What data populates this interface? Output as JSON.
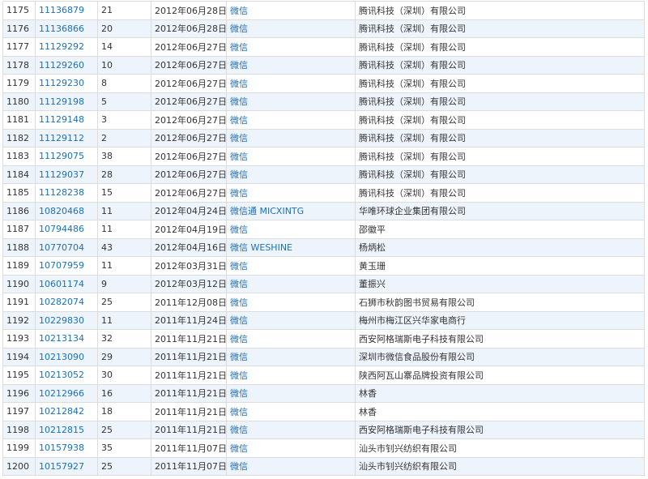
{
  "rows": [
    {
      "no": "1175",
      "reg": "11136879",
      "cls": "21",
      "date": "2012年06月28日",
      "mark": "微信",
      "owner": "腾讯科技（深圳）有限公司"
    },
    {
      "no": "1176",
      "reg": "11136866",
      "cls": "20",
      "date": "2012年06月28日",
      "mark": "微信",
      "owner": "腾讯科技（深圳）有限公司"
    },
    {
      "no": "1177",
      "reg": "11129292",
      "cls": "14",
      "date": "2012年06月27日",
      "mark": "微信",
      "owner": "腾讯科技（深圳）有限公司"
    },
    {
      "no": "1178",
      "reg": "11129260",
      "cls": "10",
      "date": "2012年06月27日",
      "mark": "微信",
      "owner": "腾讯科技（深圳）有限公司"
    },
    {
      "no": "1179",
      "reg": "11129230",
      "cls": "8",
      "date": "2012年06月27日",
      "mark": "微信",
      "owner": "腾讯科技（深圳）有限公司"
    },
    {
      "no": "1180",
      "reg": "11129198",
      "cls": "5",
      "date": "2012年06月27日",
      "mark": "微信",
      "owner": "腾讯科技（深圳）有限公司"
    },
    {
      "no": "1181",
      "reg": "11129148",
      "cls": "3",
      "date": "2012年06月27日",
      "mark": "微信",
      "owner": "腾讯科技（深圳）有限公司"
    },
    {
      "no": "1182",
      "reg": "11129112",
      "cls": "2",
      "date": "2012年06月27日",
      "mark": "微信",
      "owner": "腾讯科技（深圳）有限公司"
    },
    {
      "no": "1183",
      "reg": "11129075",
      "cls": "38",
      "date": "2012年06月27日",
      "mark": "微信",
      "owner": "腾讯科技（深圳）有限公司"
    },
    {
      "no": "1184",
      "reg": "11129037",
      "cls": "28",
      "date": "2012年06月27日",
      "mark": "微信",
      "owner": "腾讯科技（深圳）有限公司"
    },
    {
      "no": "1185",
      "reg": "11128238",
      "cls": "15",
      "date": "2012年06月27日",
      "mark": "微信",
      "owner": "腾讯科技（深圳）有限公司"
    },
    {
      "no": "1186",
      "reg": "10820468",
      "cls": "11",
      "date": "2012年04月24日",
      "mark": "微信通 MICXINTG",
      "owner": "华唯环球企业集团有限公司"
    },
    {
      "no": "1187",
      "reg": "10794486",
      "cls": "11",
      "date": "2012年04月19日",
      "mark": "微信",
      "owner": "邵徽平"
    },
    {
      "no": "1188",
      "reg": "10770704",
      "cls": "43",
      "date": "2012年04月16日",
      "mark": "微信 WESHINE",
      "owner": "杨炳松"
    },
    {
      "no": "1189",
      "reg": "10707959",
      "cls": "11",
      "date": "2012年03月31日",
      "mark": "微信",
      "owner": "黄玉珊"
    },
    {
      "no": "1190",
      "reg": "10601174",
      "cls": "9",
      "date": "2012年03月12日",
      "mark": "微信",
      "owner": "董振兴"
    },
    {
      "no": "1191",
      "reg": "10282074",
      "cls": "25",
      "date": "2011年12月08日",
      "mark": "微信",
      "owner": "石狮市秋韵图书贸易有限公司"
    },
    {
      "no": "1192",
      "reg": "10229830",
      "cls": "11",
      "date": "2011年11月24日",
      "mark": "微信",
      "owner": "梅州市梅江区兴华家电商行"
    },
    {
      "no": "1193",
      "reg": "10213134",
      "cls": "32",
      "date": "2011年11月21日",
      "mark": "微信",
      "owner": "西安阿格瑞斯电子科技有限公司"
    },
    {
      "no": "1194",
      "reg": "10213090",
      "cls": "29",
      "date": "2011年11月21日",
      "mark": "微信",
      "owner": "深圳市微信食品股份有限公司"
    },
    {
      "no": "1195",
      "reg": "10213052",
      "cls": "30",
      "date": "2011年11月21日",
      "mark": "微信",
      "owner": "陕西阿瓦山寨品牌投资有限公司"
    },
    {
      "no": "1196",
      "reg": "10212966",
      "cls": "16",
      "date": "2011年11月21日",
      "mark": "微信",
      "owner": "林香"
    },
    {
      "no": "1197",
      "reg": "10212842",
      "cls": "18",
      "date": "2011年11月21日",
      "mark": "微信",
      "owner": "林香"
    },
    {
      "no": "1198",
      "reg": "10212815",
      "cls": "25",
      "date": "2011年11月21日",
      "mark": "微信",
      "owner": "西安阿格瑞斯电子科技有限公司"
    },
    {
      "no": "1199",
      "reg": "10157938",
      "cls": "35",
      "date": "2011年11月07日",
      "mark": "微信",
      "owner": "汕头市钊兴纺织有限公司"
    },
    {
      "no": "1200",
      "reg": "10157927",
      "cls": "25",
      "date": "2011年11月07日",
      "mark": "微信",
      "owner": "汕头市钊兴纺织有限公司"
    }
  ]
}
